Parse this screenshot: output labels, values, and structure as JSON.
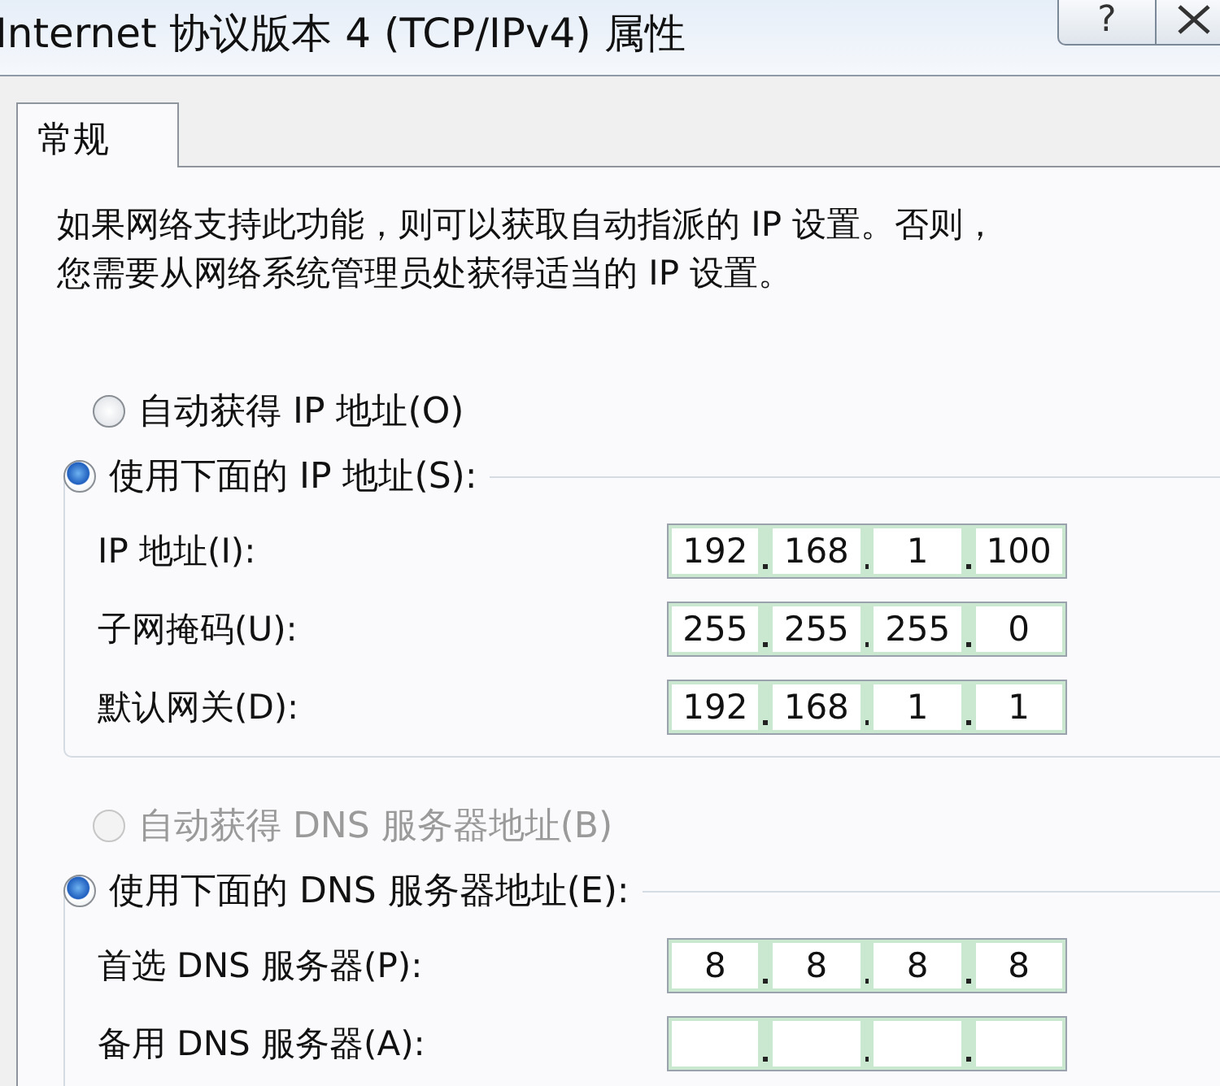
{
  "window": {
    "title": "Internet 协议版本 4 (TCP/IPv4) 属性",
    "buttons": [
      {
        "kind": "help",
        "label": "?"
      },
      {
        "kind": "close"
      }
    ]
  },
  "tabs": [
    {
      "label": "常规",
      "selected": true
    }
  ],
  "description": [
    "如果网络支持此功能，则可以获取自动指派的 IP 设置。否则，",
    "您需要从网络系统管理员处获得适当的 IP 设置。"
  ],
  "sections": [
    {
      "options": [
        {
          "label": "自动获得 IP 地址(O)",
          "selected": false,
          "disabled": false
        },
        {
          "label": "使用下面的 IP 地址(S):",
          "selected": true,
          "disabled": false
        }
      ],
      "fields": [
        {
          "label": "IP 地址(I):",
          "octets": [
            "192",
            "168",
            "1",
            "100"
          ]
        },
        {
          "label": "子网掩码(U):",
          "octets": [
            "255",
            "255",
            "255",
            "0"
          ]
        },
        {
          "label": "默认网关(D):",
          "octets": [
            "192",
            "168",
            "1",
            "1"
          ]
        }
      ]
    },
    {
      "options": [
        {
          "label": "自动获得 DNS 服务器地址(B)",
          "selected": false,
          "disabled": true
        },
        {
          "label": "使用下面的 DNS 服务器地址(E):",
          "selected": true,
          "disabled": false
        }
      ],
      "fields": [
        {
          "label": "首选 DNS 服务器(P):",
          "octets": [
            "8",
            "8",
            "8",
            "8"
          ]
        },
        {
          "label": "备用 DNS 服务器(A):"
        }
      ]
    }
  ]
}
